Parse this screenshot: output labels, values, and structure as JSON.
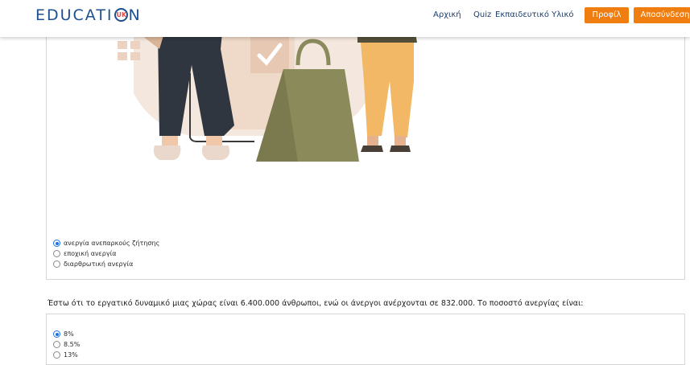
{
  "header": {
    "logo_left": "EDUCATI",
    "logo_badge": "UK",
    "logo_right": "N",
    "nav": [
      "Αρχική",
      "Quiz",
      "Εκπαιδευτικό Υλικό"
    ],
    "profile_button": "Προφίλ",
    "logout_button": "Αποσύνδεση"
  },
  "question1": {
    "options": [
      {
        "label": "ανεργία ανεπαρκούς ζήτησης",
        "selected": true
      },
      {
        "label": "εποχική ανεργία",
        "selected": false
      },
      {
        "label": "διαρθρωτική ανεργία",
        "selected": false
      }
    ]
  },
  "question2": {
    "text": "Έστω ότι το εργατικό δυναμικό μιας χώρας είναι 6.400.000 άνθρωποι, ενώ οι άνεργοι ανέρχονται σε 832.000. Το ποσοστό ανεργίας είναι:",
    "options": [
      {
        "label": "8%",
        "selected": true
      },
      {
        "label": "8.5%",
        "selected": false
      },
      {
        "label": "13%",
        "selected": false
      }
    ]
  },
  "colors": {
    "accent": "#ef7d10",
    "brand": "#1d4f91",
    "radio_selected": "#1a73e8"
  }
}
